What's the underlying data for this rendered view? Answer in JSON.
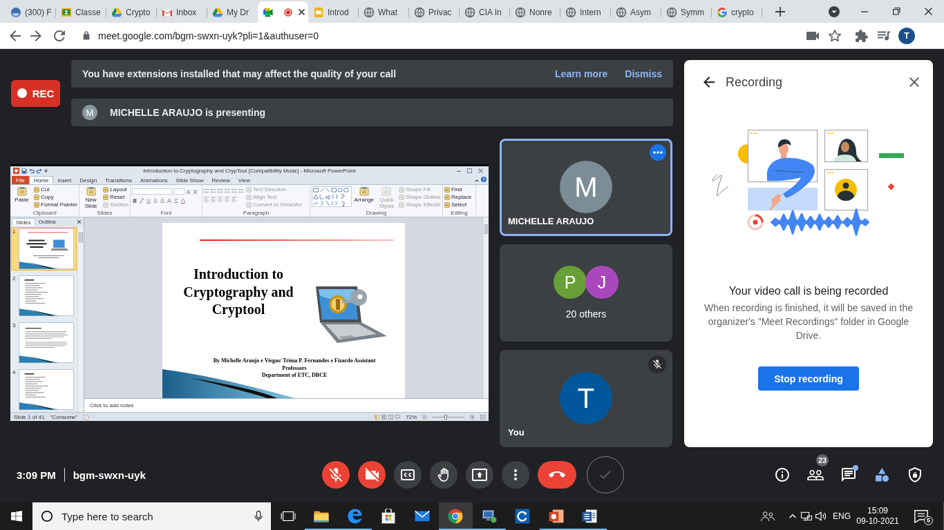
{
  "browser": {
    "tabs": [
      {
        "kind": "round",
        "title": "(300) F",
        "selected": false,
        "recording": false
      },
      {
        "kind": "board",
        "title": "Classe",
        "selected": false,
        "recording": false
      },
      {
        "kind": "triangle",
        "title": "Crypto",
        "selected": false,
        "recording": false
      },
      {
        "kind": "mail",
        "title": "Inbox",
        "selected": false,
        "recording": false
      },
      {
        "kind": "triangle",
        "title": "My Dr",
        "selected": false,
        "recording": false
      },
      {
        "kind": "camera",
        "selected": true,
        "recording": true
      },
      {
        "kind": "slides",
        "title": "Introd",
        "selected": false,
        "recording": false
      },
      {
        "kind": "globe",
        "title": "What",
        "selected": false,
        "recording": false
      },
      {
        "kind": "globe",
        "title": "Privac",
        "selected": false,
        "recording": false
      },
      {
        "kind": "globe",
        "title": "CIA In",
        "selected": false,
        "recording": false
      },
      {
        "kind": "globe",
        "title": "Nonre",
        "selected": false,
        "recording": false
      },
      {
        "kind": "globe",
        "title": "Intern",
        "selected": false,
        "recording": false
      },
      {
        "kind": "globe",
        "title": "Asym",
        "selected": false,
        "recording": false
      },
      {
        "kind": "globe",
        "title": "Symm",
        "selected": false,
        "recording": false
      },
      {
        "kind": "g",
        "title": "crypto",
        "selected": false,
        "recording": false
      }
    ],
    "url": "meet.google.com/bgm-swxn-uyk?pli=1&authuser=0",
    "profile_initial": "T"
  },
  "meet": {
    "notice": {
      "text": "You have extensions installed that may affect the quality of your call",
      "actions": [
        "Learn more",
        "Dismiss"
      ]
    },
    "recording_badge": "REC",
    "presenter": {
      "initial": "M",
      "text": "MICHELLE ARAUJO is presenting"
    },
    "presentation": {
      "title": "Introduction to Cryptography and CrypTool [Compatibility Mode] - Microsoft PowerPoint",
      "tabs": [
        {
          "kind": "file",
          "label": "File",
          "selected": false
        },
        {
          "kind": "tab",
          "label": "Home",
          "selected": true
        },
        {
          "kind": "tab",
          "label": "Insert",
          "selected": false
        },
        {
          "kind": "tab",
          "label": "Design",
          "selected": false
        },
        {
          "kind": "tab",
          "label": "Transitions",
          "selected": false
        },
        {
          "kind": "tab",
          "label": "Animations",
          "selected": false
        },
        {
          "kind": "tab",
          "label": "Slide Show",
          "selected": false
        },
        {
          "kind": "tab",
          "label": "Review",
          "selected": false
        },
        {
          "kind": "tab",
          "label": "View",
          "selected": false
        }
      ],
      "groups": [
        {
          "kind": "clipboard",
          "label": "Clipboard",
          "commands": [
            {
              "kind": "large",
              "label": "Paste",
              "disabled": false
            },
            {
              "kind": "small",
              "label": "Cut",
              "disabled": false
            },
            {
              "kind": "small",
              "label": "Copy",
              "disabled": false
            },
            {
              "kind": "small",
              "label": "Format Painter",
              "disabled": false
            }
          ]
        },
        {
          "kind": "slides",
          "label": "Slides",
          "commands": [
            {
              "kind": "large",
              "label": "New Slide",
              "disabled": false
            },
            {
              "kind": "small",
              "label": "Layout",
              "disabled": false
            },
            {
              "kind": "small",
              "label": "Reset",
              "disabled": false
            },
            {
              "kind": "small",
              "label": "Section",
              "disabled": true
            }
          ]
        },
        {
          "kind": "font",
          "label": "Font"
        },
        {
          "kind": "paragraph",
          "label": "Paragraph",
          "commands": [
            {
              "kind": "small",
              "label": "Text Direction",
              "disabled": true
            },
            {
              "kind": "small",
              "label": "Align Text",
              "disabled": true
            },
            {
              "kind": "small",
              "label": "Convert to SmartArt",
              "disabled": true
            }
          ]
        },
        {
          "kind": "drawing",
          "label": "Drawing",
          "commands": [
            {
              "kind": "large",
              "label": "Arrange",
              "disabled": false
            },
            {
              "kind": "large",
              "label": "Quick Styles",
              "disabled": true
            },
            {
              "kind": "small",
              "label": "Shape Fill",
              "disabled": true
            },
            {
              "kind": "small",
              "label": "Shape Outline",
              "disabled": true
            },
            {
              "kind": "small",
              "label": "Shape Effects",
              "disabled": true
            }
          ]
        },
        {
          "kind": "editing",
          "label": "Editing",
          "commands": [
            {
              "kind": "small",
              "label": "Find",
              "disabled": false
            },
            {
              "kind": "small",
              "label": "Replace",
              "disabled": false
            },
            {
              "kind": "small",
              "label": "Select",
              "disabled": false
            }
          ]
        }
      ],
      "panel_tabs": [
        {
          "label": "Slides",
          "selected": true
        },
        {
          "label": "Outline",
          "selected": false
        }
      ],
      "thumbnails": [
        {
          "number": "1",
          "kind": "title",
          "selected": true
        },
        {
          "number": "2",
          "kind": "list",
          "selected": false
        },
        {
          "number": "3",
          "kind": "text",
          "selected": false
        },
        {
          "number": "4",
          "kind": "list",
          "selected": false
        }
      ],
      "slide": {
        "title": "Introduction to Cryptography and Cryptool",
        "authors": "By Michelle Araujo e Viegas/ Trima P. Fernandes e Fizardo Assistant Professors",
        "department": "Department of ETC, DBCE"
      },
      "notes": {
        "placeholder": "Click to add notes"
      },
      "status": {
        "slide": "Slide 1 of 41",
        "theme": "\"Consume\"",
        "zoom": "72%",
        "zoom_slider": {
          "level": 0.4
        }
      }
    },
    "tiles": [
      {
        "kind": "person",
        "name": "MICHELLE ARAUJO",
        "initial": "M",
        "color": "#7b8d96",
        "selected": true,
        "muted": false
      },
      {
        "kind": "group",
        "avatars": [
          {
            "initial": "P",
            "color": "#689f38"
          },
          {
            "initial": "J",
            "color": "#ab47bc"
          }
        ],
        "label": "20 others",
        "selected": false,
        "muted": false
      },
      {
        "kind": "person",
        "name": "You",
        "initial": "T",
        "color": "#01579b",
        "selected": false,
        "muted": true
      }
    ],
    "panel": {
      "title": "Recording",
      "heading": "Your video call is being recorded",
      "body": "When recording is finished, it will be saved in the organizer's \"Meet Recordings\" folder in Google Drive.",
      "button": "Stop recording"
    },
    "clock": "3:09 PM",
    "meeting_code": "bgm-swxn-uyk",
    "controls": [
      {
        "kind": "mic",
        "on": false
      },
      {
        "kind": "camera",
        "on": false
      },
      {
        "kind": "captions",
        "on": false
      },
      {
        "kind": "hand",
        "on": false
      },
      {
        "kind": "present",
        "on": false
      },
      {
        "kind": "more"
      },
      {
        "kind": "leave"
      },
      {
        "kind": "check"
      }
    ],
    "side_buttons": [
      {
        "kind": "info"
      },
      {
        "kind": "people",
        "badge": "23"
      },
      {
        "kind": "chat",
        "unread": true
      },
      {
        "kind": "activities"
      },
      {
        "kind": "host"
      }
    ]
  },
  "taskbar": {
    "search": {
      "placeholder": "Type here to search"
    },
    "apps": [
      {
        "kind": "folder",
        "open": true,
        "selected": false
      },
      {
        "kind": "e-logo",
        "open": true,
        "selected": false
      },
      {
        "kind": "store",
        "open": false,
        "selected": false
      },
      {
        "kind": "mail",
        "open": false,
        "selected": false
      },
      {
        "kind": "browser",
        "open": true,
        "selected": true
      },
      {
        "kind": "computer",
        "open": true,
        "selected": false
      },
      {
        "kind": "sync",
        "open": false,
        "selected": false
      },
      {
        "kind": "presentation",
        "open": true,
        "selected": false
      },
      {
        "kind": "document",
        "open": true,
        "selected": false
      }
    ],
    "language": "ENG",
    "time": "15:09",
    "date": "09-10-2021",
    "notifications": "5"
  }
}
